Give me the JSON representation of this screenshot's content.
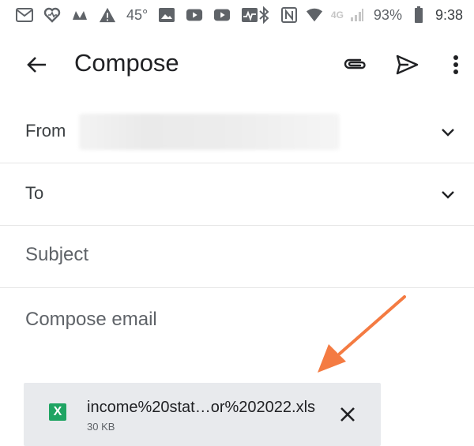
{
  "status_bar": {
    "temperature": "45°",
    "network": "4G",
    "battery": "93%",
    "time": "9:38",
    "icons": [
      "gmail-icon",
      "health-heart-icon",
      "nbc-icon",
      "warning-icon",
      "image-icon",
      "youtube-icon",
      "youtube-icon",
      "pulse-icon",
      "bluetooth-icon",
      "nfc-icon",
      "wifi-icon",
      "signal-icon",
      "battery-icon"
    ]
  },
  "app_bar": {
    "title": "Compose",
    "icons": [
      "back-arrow-icon",
      "paperclip-icon",
      "send-icon",
      "more-vert-icon"
    ]
  },
  "fields": {
    "from_label": "From",
    "to_label": "To",
    "subject_placeholder": "Subject",
    "body_placeholder": "Compose email"
  },
  "attachment": {
    "icon_letter": "X",
    "file_name": "income%20stat…or%202022.xls",
    "file_size": "30 KB"
  },
  "colors": {
    "annotation_arrow": "#f47b42",
    "xls_icon": "#1fa463",
    "chip_background": "#e8eaed"
  }
}
